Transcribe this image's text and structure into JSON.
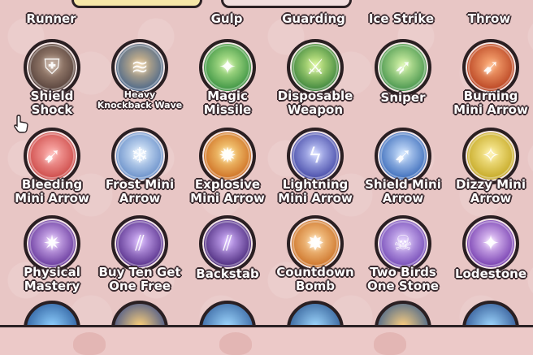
{
  "top_row_labels": [
    "Runner",
    "Gulp",
    "Guarding",
    "Ice Strike",
    "Throw"
  ],
  "skills": [
    {
      "row": 0,
      "col": 0,
      "lines": [
        "Shield",
        "Shock"
      ],
      "style": "normal",
      "icon": "shield-icon",
      "c1": "#b79a86",
      "c2": "#4e3a35",
      "glyph": "⛨"
    },
    {
      "row": 0,
      "col": 1,
      "lines": [
        "Heavy",
        "Knockback Wave"
      ],
      "style": "small",
      "icon": "wave-icon",
      "c1": "#e6c28a",
      "c2": "#3d5f8a",
      "glyph": "≋"
    },
    {
      "row": 0,
      "col": 2,
      "lines": [
        "Magic",
        "Missile"
      ],
      "style": "normal",
      "icon": "magic-missile-icon",
      "c1": "#c8f29a",
      "c2": "#2e8a3a",
      "glyph": "✦"
    },
    {
      "row": 0,
      "col": 3,
      "lines": [
        "Disposable",
        "Weapon"
      ],
      "style": "normal",
      "icon": "sword-icon",
      "c1": "#d6f58c",
      "c2": "#2e7a35",
      "glyph": "⚔"
    },
    {
      "row": 0,
      "col": 4,
      "lines": [
        "Sniper"
      ],
      "style": "normal",
      "icon": "sniper-icon",
      "c1": "#d9f7a9",
      "c2": "#3a8c45",
      "glyph": "➶"
    },
    {
      "row": 0,
      "col": 5,
      "lines": [
        "Burning",
        "Mini Arrow"
      ],
      "style": "normal",
      "icon": "fire-arrow-icon",
      "c1": "#ffb07a",
      "c2": "#b33a1a",
      "glyph": "➹"
    },
    {
      "row": 1,
      "col": 0,
      "lines": [
        "Bleeding",
        "Mini Arrow"
      ],
      "style": "normal",
      "icon": "bleed-arrow-icon",
      "c1": "#ffb3b0",
      "c2": "#c8403e",
      "glyph": "➹"
    },
    {
      "row": 1,
      "col": 1,
      "lines": [
        "Frost Mini",
        "Arrow"
      ],
      "style": "normal",
      "icon": "frost-arrow-icon",
      "c1": "#e3f1ff",
      "c2": "#5d86c4",
      "glyph": "❄"
    },
    {
      "row": 1,
      "col": 2,
      "lines": [
        "Explosive",
        "Mini Arrow"
      ],
      "style": "normal",
      "icon": "explosive-arrow-icon",
      "c1": "#ffe08a",
      "c2": "#c9651a",
      "glyph": "✹"
    },
    {
      "row": 1,
      "col": 3,
      "lines": [
        "Lightning",
        "Mini Arrow"
      ],
      "style": "normal",
      "icon": "lightning-arrow-icon",
      "c1": "#c8d0ff",
      "c2": "#3b3fa0",
      "glyph": "ϟ"
    },
    {
      "row": 1,
      "col": 4,
      "lines": [
        "Shield Mini",
        "Arrow"
      ],
      "style": "normal",
      "icon": "shield-arrow-icon",
      "c1": "#cfe4ff",
      "c2": "#2f62b5",
      "glyph": "➹"
    },
    {
      "row": 1,
      "col": 5,
      "lines": [
        "Dizzy Mini",
        "Arrow"
      ],
      "style": "normal",
      "icon": "dizzy-arrow-icon",
      "c1": "#fff1a0",
      "c2": "#c0a21a",
      "glyph": "✧"
    },
    {
      "row": 2,
      "col": 0,
      "lines": [
        "Physical",
        "Mastery"
      ],
      "style": "normal",
      "icon": "physical-mastery-icon",
      "c1": "#e7c9ff",
      "c2": "#5b2a93",
      "glyph": "✷"
    },
    {
      "row": 2,
      "col": 1,
      "lines": [
        "Buy Ten Get",
        "One Free"
      ],
      "style": "normal",
      "icon": "buy-ten-icon",
      "c1": "#d9b8ff",
      "c2": "#4b2380",
      "glyph": "⫽"
    },
    {
      "row": 2,
      "col": 2,
      "lines": [
        "Backstab"
      ],
      "style": "normal",
      "icon": "backstab-icon",
      "c1": "#d2b0ff",
      "c2": "#3f1e70",
      "glyph": "⫽"
    },
    {
      "row": 2,
      "col": 3,
      "lines": [
        "Countdown",
        "Bomb"
      ],
      "style": "normal",
      "icon": "bomb-icon",
      "c1": "#ffd9a0",
      "c2": "#c86a1e",
      "glyph": "✸"
    },
    {
      "row": 2,
      "col": 4,
      "lines": [
        "Two Birds",
        "One Stone"
      ],
      "style": "normal",
      "icon": "skull-icon",
      "c1": "#e2cdff",
      "c2": "#6b3fb0",
      "glyph": "☠"
    },
    {
      "row": 2,
      "col": 5,
      "lines": [
        "Lodestone"
      ],
      "style": "normal",
      "icon": "lodestone-icon",
      "c1": "#efd4ff",
      "c2": "#6a2fa8",
      "glyph": "✦"
    }
  ],
  "partial_row_icons": [
    {
      "icon": "skill-icon-partial-1",
      "c1": "#8fd0ff",
      "c2": "#2a5a9a"
    },
    {
      "icon": "skill-icon-partial-2",
      "c1": "#ffd27a",
      "c2": "#3d4f8a"
    },
    {
      "icon": "skill-icon-partial-3",
      "c1": "#9fd8ff",
      "c2": "#35629e"
    },
    {
      "icon": "skill-icon-partial-4",
      "c1": "#9fd8ff",
      "c2": "#2f5a93"
    },
    {
      "icon": "skill-icon-partial-5",
      "c1": "#ffd080",
      "c2": "#3d5f8a"
    },
    {
      "icon": "skill-icon-partial-6",
      "c1": "#9fd8ff",
      "c2": "#2d5290"
    }
  ]
}
